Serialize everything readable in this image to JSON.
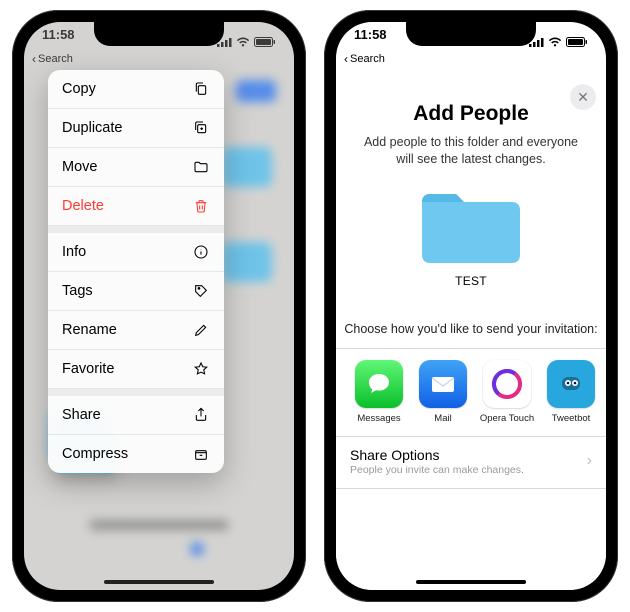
{
  "status": {
    "time": "11:58",
    "back_label": "Search"
  },
  "context_menu": {
    "items": [
      {
        "label": "Copy",
        "icon": "copy-icon",
        "danger": false
      },
      {
        "label": "Duplicate",
        "icon": "duplicate-icon",
        "danger": false
      },
      {
        "label": "Move",
        "icon": "folder-icon",
        "danger": false
      },
      {
        "label": "Delete",
        "icon": "trash-icon",
        "danger": true
      }
    ],
    "items2": [
      {
        "label": "Info",
        "icon": "info-icon",
        "danger": false
      },
      {
        "label": "Tags",
        "icon": "tag-icon",
        "danger": false
      },
      {
        "label": "Rename",
        "icon": "pencil-icon",
        "danger": false
      },
      {
        "label": "Favorite",
        "icon": "star-icon",
        "danger": false
      }
    ],
    "items3": [
      {
        "label": "Share",
        "icon": "share-icon",
        "danger": false
      },
      {
        "label": "Compress",
        "icon": "archive-icon",
        "danger": false
      }
    ]
  },
  "add_people": {
    "title": "Add People",
    "subtitle": "Add people to this folder and everyone will see the latest changes.",
    "folder_name": "TEST",
    "invite_head": "Choose how you'd like to send your invitation:",
    "apps": [
      {
        "label": "Messages",
        "bg": "#34c759",
        "kind": "messages"
      },
      {
        "label": "Mail",
        "bg": "#ffffff",
        "kind": "mail"
      },
      {
        "label": "Opera Touch",
        "bg": "#ffffff",
        "kind": "opera"
      },
      {
        "label": "Tweetbot",
        "bg": "#28a6de",
        "kind": "tweetbot"
      }
    ],
    "share_options": {
      "title": "Share Options",
      "subtitle": "People you invite can make changes."
    }
  },
  "colors": {
    "folder": "#6fc8ef",
    "danger": "#ff3b30"
  }
}
